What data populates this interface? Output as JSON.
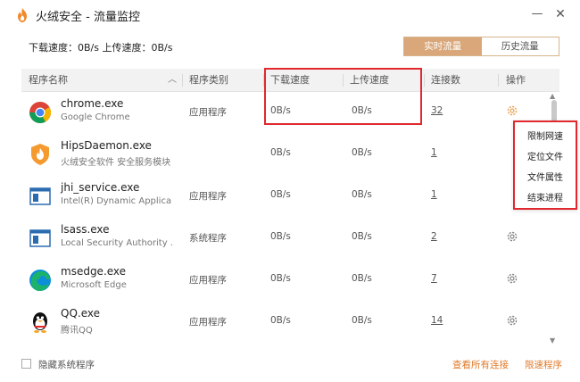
{
  "window": {
    "title": "火绒安全 - 流量监控",
    "minimize": "—",
    "close": "✕"
  },
  "summary": {
    "download_label": "下载速度：",
    "download_value": "0B/s",
    "upload_label": "上传速度：",
    "upload_value": "0B/s"
  },
  "tabs": [
    "实时流量",
    "历史流量"
  ],
  "columns": {
    "name": "程序名称",
    "type": "程序类别",
    "download": "下载速度",
    "upload": "上传速度",
    "connections": "连接数",
    "action": "操作"
  },
  "rows": [
    {
      "name": "chrome.exe",
      "desc": "Google Chrome",
      "type": "应用程序",
      "down": "0B/s",
      "up": "0B/s",
      "conn": "32",
      "icon": "chrome-icon"
    },
    {
      "name": "HipsDaemon.exe",
      "desc": "火绒安全软件 安全服务模块",
      "type": "",
      "down": "0B/s",
      "up": "0B/s",
      "conn": "1",
      "icon": "huorong-icon"
    },
    {
      "name": "jhi_service.exe",
      "desc": "Intel(R) Dynamic Applica...",
      "type": "应用程序",
      "down": "0B/s",
      "up": "0B/s",
      "conn": "1",
      "icon": "window-app-icon"
    },
    {
      "name": "lsass.exe",
      "desc": "Local Security Authority ...",
      "type": "系统程序",
      "down": "0B/s",
      "up": "0B/s",
      "conn": "2",
      "icon": "window-app-icon"
    },
    {
      "name": "msedge.exe",
      "desc": "Microsoft Edge",
      "type": "应用程序",
      "down": "0B/s",
      "up": "0B/s",
      "conn": "7",
      "icon": "edge-icon"
    },
    {
      "name": "QQ.exe",
      "desc": "腾讯QQ",
      "type": "应用程序",
      "down": "0B/s",
      "up": "0B/s",
      "conn": "14",
      "icon": "qq-icon"
    }
  ],
  "context_menu": [
    "限制网速",
    "定位文件",
    "文件属性",
    "结束进程"
  ],
  "footer": {
    "hide_system": "隐藏系统程序",
    "view_all": "查看所有连接",
    "limit_speed": "限速程序"
  },
  "colors": {
    "accent": "#d9a77a",
    "link": "#e07a2a",
    "highlight": "#e0282e"
  }
}
